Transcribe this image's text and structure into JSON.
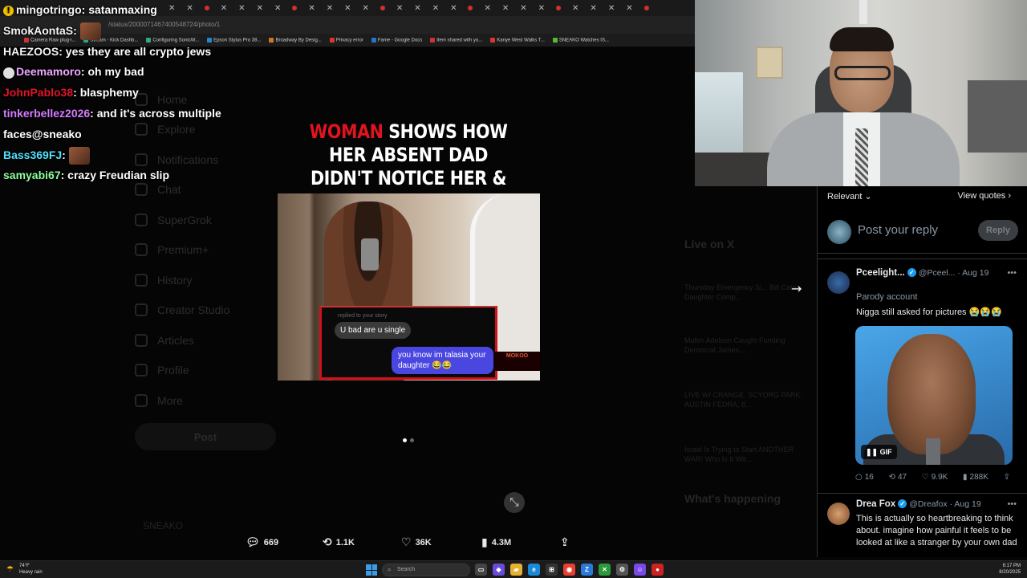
{
  "browser": {
    "address": "/status/2000071467400548724/photo/1",
    "bookmarks": [
      "Camera Raw plug-i...",
      "Stream - Kick Dashb...",
      "Configuring SonicW...",
      "Epson Stylus Pro 38...",
      "Broadway By Desig...",
      "Privacy error",
      "Fame - Google Docs",
      "Item shared with yo...",
      "Kanye West Walks T...",
      "SNEAKO Watches IS..."
    ],
    "bookmark_colors": [
      "#c33",
      "#2a8",
      "#3a7",
      "#28c",
      "#c72",
      "#d33",
      "#27c",
      "#c33",
      "#d33",
      "#5b3"
    ]
  },
  "chat": [
    {
      "user": "mingotringo",
      "color": "#f5f5f5",
      "message": " satanmaxing",
      "alert_badge": "!"
    },
    {
      "user": "SmokAontaS",
      "color": "#f5f5f5",
      "message": "",
      "emote": true
    },
    {
      "user": "HAEZOOS",
      "color": "#f5f5f5",
      "message": " yes they are all crypto jews"
    },
    {
      "user": "Deemamoro",
      "color": "#f0a6ff",
      "message": " oh my bad",
      "badge": true
    },
    {
      "user": "JohnPablo38",
      "color": "#e0142a",
      "message": " blasphemy"
    },
    {
      "user": "tinkerbellez2026",
      "color": "#d47cff",
      "message": " and it's across multiple"
    },
    {
      "user": "",
      "color": "#ffffff",
      "message": "faces@sneako"
    },
    {
      "user": "Bass369FJ",
      "color": "#4fe0ff",
      "message": "",
      "emote": true
    },
    {
      "user": "samyabi67",
      "color": "#8dff9b",
      "message": " crazy Freudian slip"
    }
  ],
  "sidebar": {
    "items": [
      "Home",
      "Explore",
      "Notifications",
      "Chat",
      "SuperGrok",
      "Premium+",
      "History",
      "Creator Studio",
      "Articles",
      "Profile",
      "More"
    ],
    "post_label": "Post",
    "profile_name": "SNEAKO"
  },
  "media": {
    "headline_red": "WOMAN",
    "headline_rest": " SHOWS HOW HER ABSENT DAD DIDN'T NOTICE HER & ASKED HER WAS SHE SINGLE",
    "dm_reply": "replied to your story",
    "bubble_left": "U bad are u single",
    "bubble_right": "you know im talasia your daughter 😂😂",
    "watermark": "MOKOO"
  },
  "actions": {
    "replies": "669",
    "reposts": "1.1K",
    "likes": "36K",
    "views": "4.3M"
  },
  "dim_right": {
    "live_heading": "Live on X",
    "whats_happening": "What's happening",
    "items": [
      "Thursday Emergency Si... Bill Cates Daughter Comp...",
      "Mufim Adelson Caught Funding Democrat James...",
      "LIVE W/ CRANGE, SCYORG PARK, AUSTIN FEDRA, 8...",
      "Israel Is Trying to Start ANOTHER WAR! Who Is It Wit..."
    ]
  },
  "replies": {
    "sort_label": "Relevant",
    "view_quotes": "View quotes",
    "placeholder": "Post your reply",
    "reply_button": "Reply",
    "tweet1": {
      "name": "Pceelight...",
      "handle": "@Pceel...",
      "date": "Aug 19",
      "parody": "Parody account",
      "text": "Nigga still asked for pictures 😭😭😭",
      "gif_label": "GIF",
      "replies": "16",
      "reposts": "47",
      "likes": "9.9K",
      "views": "288K"
    },
    "tweet2": {
      "name": "Drea Fox",
      "handle": "@Dreafox",
      "date": "Aug 19",
      "text": "This is actually so heartbreaking to think about. imagine how painful it feels to be looked at like a stranger by your own dad"
    }
  },
  "taskbar": {
    "weather_temp": "74°F",
    "weather_desc": "Heavy rain",
    "search_placeholder": "Search",
    "time": "6:17 PM",
    "date": "8/20/2025"
  },
  "colors": {
    "accent_blue": "#1d9bf0",
    "headline_red": "#e0141c",
    "dm_blue": "#4a46e0"
  }
}
